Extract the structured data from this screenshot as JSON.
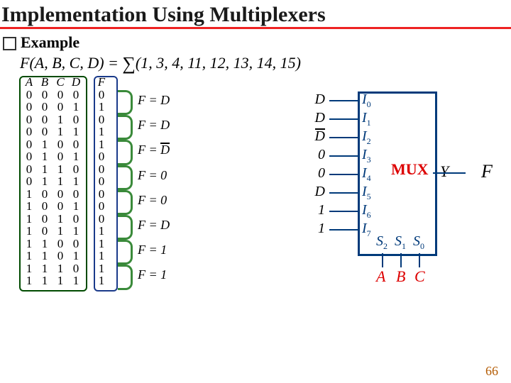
{
  "title": "Implementation Using Multiplexers",
  "example_label": "Example",
  "equation_lhs": "F(A, B, C, D) = ",
  "equation_rhs": "(1, 3, 4, 11, 12, 13, 14, 15)",
  "truth_table": {
    "headers": [
      "A",
      "B",
      "C",
      "D",
      "F"
    ],
    "rows": [
      [
        "0",
        "0",
        "0",
        "0",
        "0"
      ],
      [
        "0",
        "0",
        "0",
        "1",
        "1"
      ],
      [
        "0",
        "0",
        "1",
        "0",
        "0"
      ],
      [
        "0",
        "0",
        "1",
        "1",
        "1"
      ],
      [
        "0",
        "1",
        "0",
        "0",
        "1"
      ],
      [
        "0",
        "1",
        "0",
        "1",
        "0"
      ],
      [
        "0",
        "1",
        "1",
        "0",
        "0"
      ],
      [
        "0",
        "1",
        "1",
        "1",
        "0"
      ],
      [
        "1",
        "0",
        "0",
        "0",
        "0"
      ],
      [
        "1",
        "0",
        "0",
        "1",
        "0"
      ],
      [
        "1",
        "0",
        "1",
        "0",
        "0"
      ],
      [
        "1",
        "0",
        "1",
        "1",
        "1"
      ],
      [
        "1",
        "1",
        "0",
        "0",
        "1"
      ],
      [
        "1",
        "1",
        "0",
        "1",
        "1"
      ],
      [
        "1",
        "1",
        "1",
        "0",
        "1"
      ],
      [
        "1",
        "1",
        "1",
        "1",
        "1"
      ]
    ]
  },
  "groups": [
    {
      "label": "F = D"
    },
    {
      "label": "F = D"
    },
    {
      "label": "F = ",
      "bar": "D"
    },
    {
      "label": "F = 0"
    },
    {
      "label": "F = 0"
    },
    {
      "label": "F = D"
    },
    {
      "label": "F = 1"
    },
    {
      "label": "F = 1"
    }
  ],
  "mux": {
    "name": "MUX",
    "inputs": [
      "I0",
      "I1",
      "I2",
      "I3",
      "I4",
      "I5",
      "I6",
      "I7"
    ],
    "input_values": [
      "D",
      "D",
      "D̄",
      "0",
      "0",
      "D",
      "1",
      "1"
    ],
    "input_values_raw": [
      "D",
      "D",
      "Dbar",
      "0",
      "0",
      "D",
      "1",
      "1"
    ],
    "selects": [
      "S2",
      "S1",
      "S0"
    ],
    "select_values": [
      "A",
      "B",
      "C"
    ],
    "output_label": "Y",
    "output_name": "F"
  },
  "page_number": "66",
  "chart_data": {
    "type": "table",
    "title": "Truth table and 8:1 MUX mapping for F(A,B,C,D)=Σ(1,3,4,11,12,13,14,15)",
    "truth_table_columns": [
      "A",
      "B",
      "C",
      "D",
      "F"
    ],
    "truth_table_rows": [
      [
        0,
        0,
        0,
        0,
        0
      ],
      [
        0,
        0,
        0,
        1,
        1
      ],
      [
        0,
        0,
        1,
        0,
        0
      ],
      [
        0,
        0,
        1,
        1,
        1
      ],
      [
        0,
        1,
        0,
        0,
        1
      ],
      [
        0,
        1,
        0,
        1,
        0
      ],
      [
        0,
        1,
        1,
        0,
        0
      ],
      [
        0,
        1,
        1,
        1,
        0
      ],
      [
        1,
        0,
        0,
        0,
        0
      ],
      [
        1,
        0,
        0,
        1,
        0
      ],
      [
        1,
        0,
        1,
        0,
        0
      ],
      [
        1,
        0,
        1,
        1,
        1
      ],
      [
        1,
        1,
        0,
        0,
        1
      ],
      [
        1,
        1,
        0,
        1,
        1
      ],
      [
        1,
        1,
        1,
        0,
        1
      ],
      [
        1,
        1,
        1,
        1,
        1
      ]
    ],
    "mux_inputs": {
      "I0": "D",
      "I1": "D",
      "I2": "D'",
      "I3": "0",
      "I4": "0",
      "I5": "D",
      "I6": "1",
      "I7": "1"
    },
    "mux_selects": {
      "S2": "A",
      "S1": "B",
      "S0": "C"
    },
    "mux_output": "Y = F"
  }
}
